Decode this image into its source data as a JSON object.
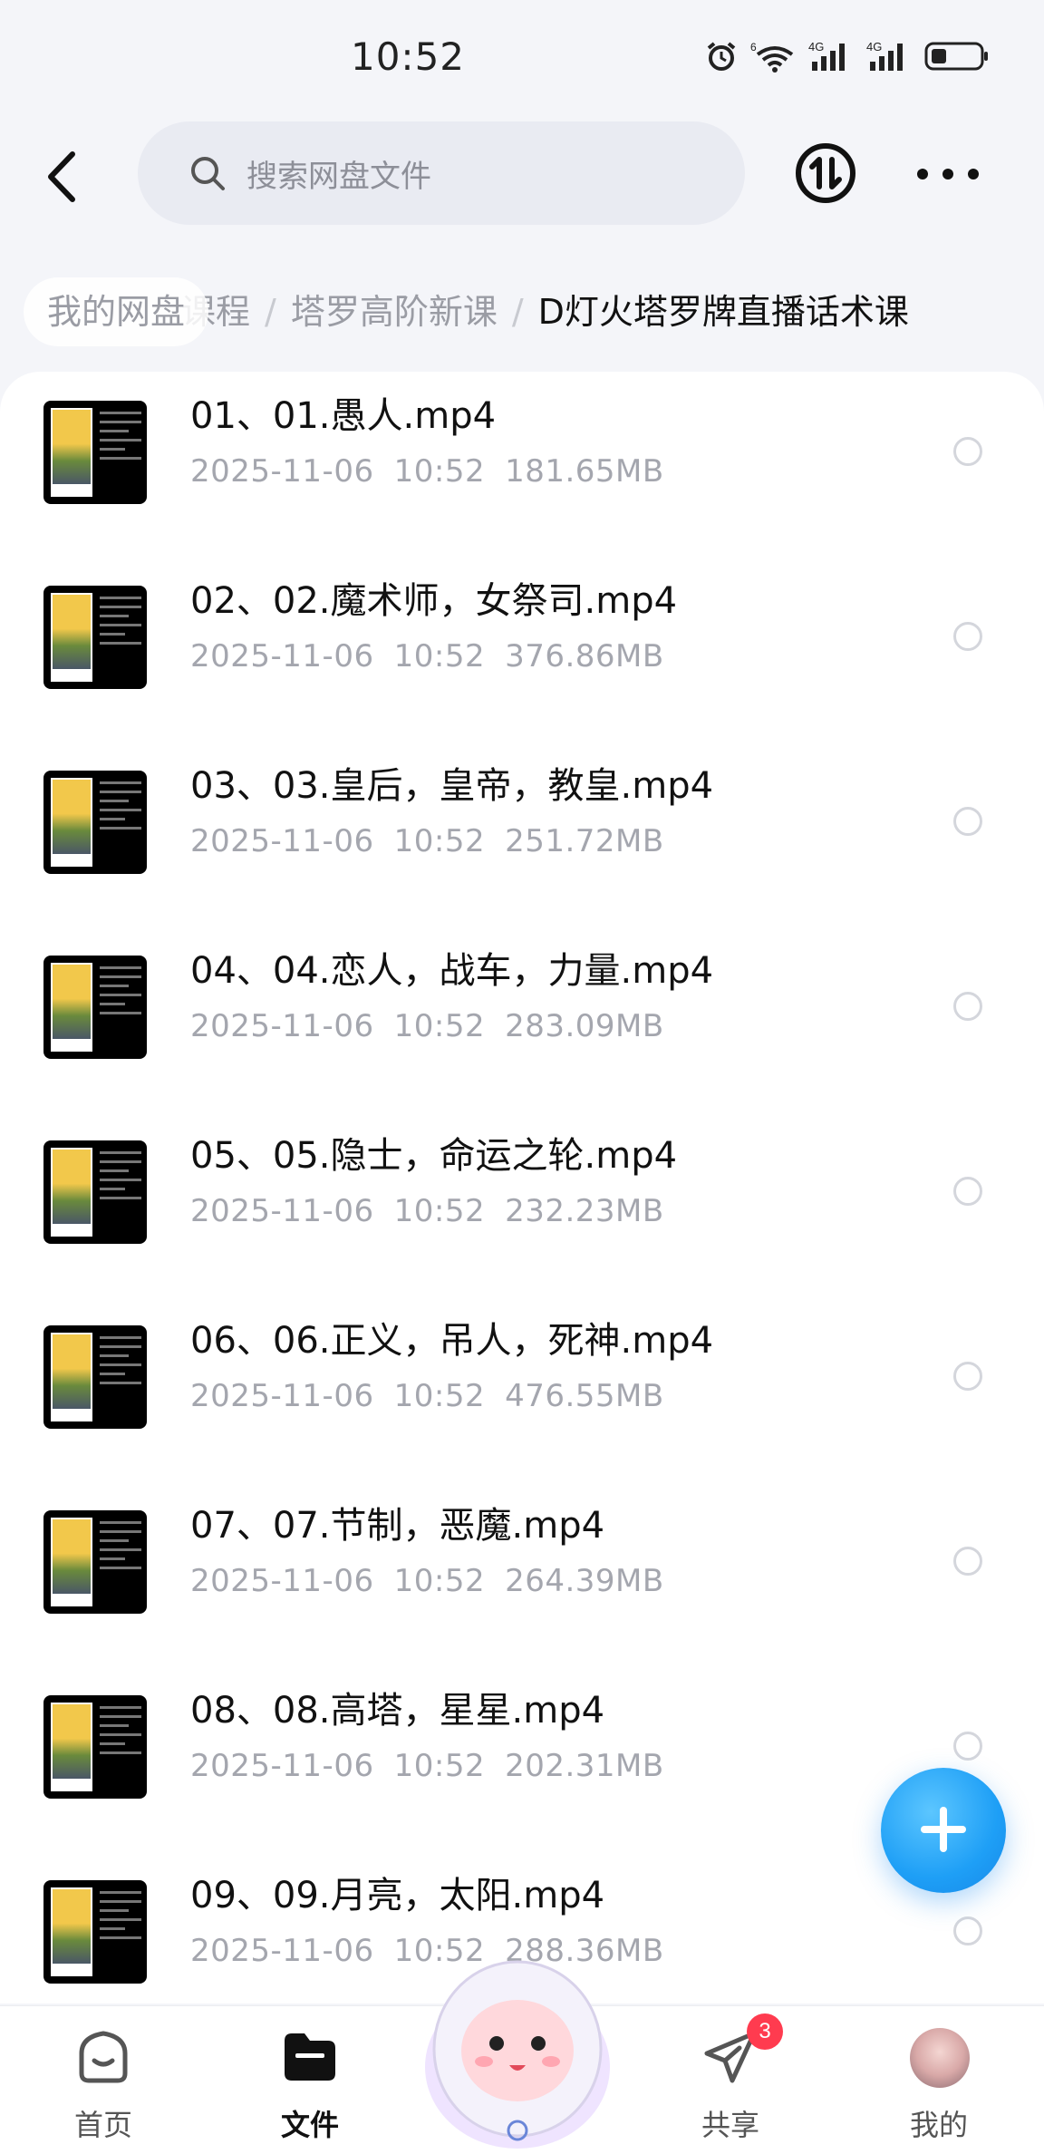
{
  "status_bar": {
    "time": "10:52",
    "icons": [
      "alarm-icon",
      "wifi-icon",
      "signal-4g-icon",
      "signal-4g-icon",
      "battery-icon"
    ],
    "signal_labels": [
      "4G",
      "4G"
    ],
    "wifi_label": "6"
  },
  "header": {
    "back_icon": "back-arrow-icon",
    "search_placeholder": "搜索网盘文件",
    "transfer_icon": "transfer-icon",
    "more_icon": "more-icon"
  },
  "breadcrumb": {
    "root": "我的网盘",
    "partial": "课程",
    "separator": "/",
    "middle": "塔罗高阶新课",
    "current": "D灯火塔罗牌直播话术课"
  },
  "files": [
    {
      "name": "01、01.愚人.mp4",
      "date": "2025-11-06",
      "time": "10:52",
      "size": "181.65MB"
    },
    {
      "name": "02、02.魔术师，女祭司.mp4",
      "date": "2025-11-06",
      "time": "10:52",
      "size": "376.86MB"
    },
    {
      "name": "03、03.皇后，皇帝，教皇.mp4",
      "date": "2025-11-06",
      "time": "10:52",
      "size": "251.72MB"
    },
    {
      "name": "04、04.恋人，战车，力量.mp4",
      "date": "2025-11-06",
      "time": "10:52",
      "size": "283.09MB"
    },
    {
      "name": "05、05.隐士，命运之轮.mp4",
      "date": "2025-11-06",
      "time": "10:52",
      "size": "232.23MB"
    },
    {
      "name": "06、06.正义，吊人，死神.mp4",
      "date": "2025-11-06",
      "time": "10:52",
      "size": "476.55MB"
    },
    {
      "name": "07、07.节制，恶魔.mp4",
      "date": "2025-11-06",
      "time": "10:52",
      "size": "264.39MB"
    },
    {
      "name": "08、08.高塔，星星.mp4",
      "date": "2025-11-06",
      "time": "10:52",
      "size": "202.31MB"
    },
    {
      "name": "09、09.月亮，太阳.mp4",
      "date": "2025-11-06",
      "time": "10:52",
      "size": "288.36MB"
    }
  ],
  "fab": {
    "icon": "plus-icon"
  },
  "bottom_nav": {
    "items": [
      {
        "label": "首页",
        "icon": "home-icon",
        "active": false
      },
      {
        "label": "文件",
        "icon": "folder-icon",
        "active": true
      },
      {
        "label": "共享",
        "icon": "share-plane-icon",
        "active": false,
        "badge": "3"
      },
      {
        "label": "我的",
        "icon": "avatar-icon",
        "active": false
      }
    ]
  },
  "colors": {
    "background": "#f4f5f9",
    "accent": "#1e9ff6",
    "badge": "#ff3b4f",
    "meta_text": "#a4a6ae"
  }
}
